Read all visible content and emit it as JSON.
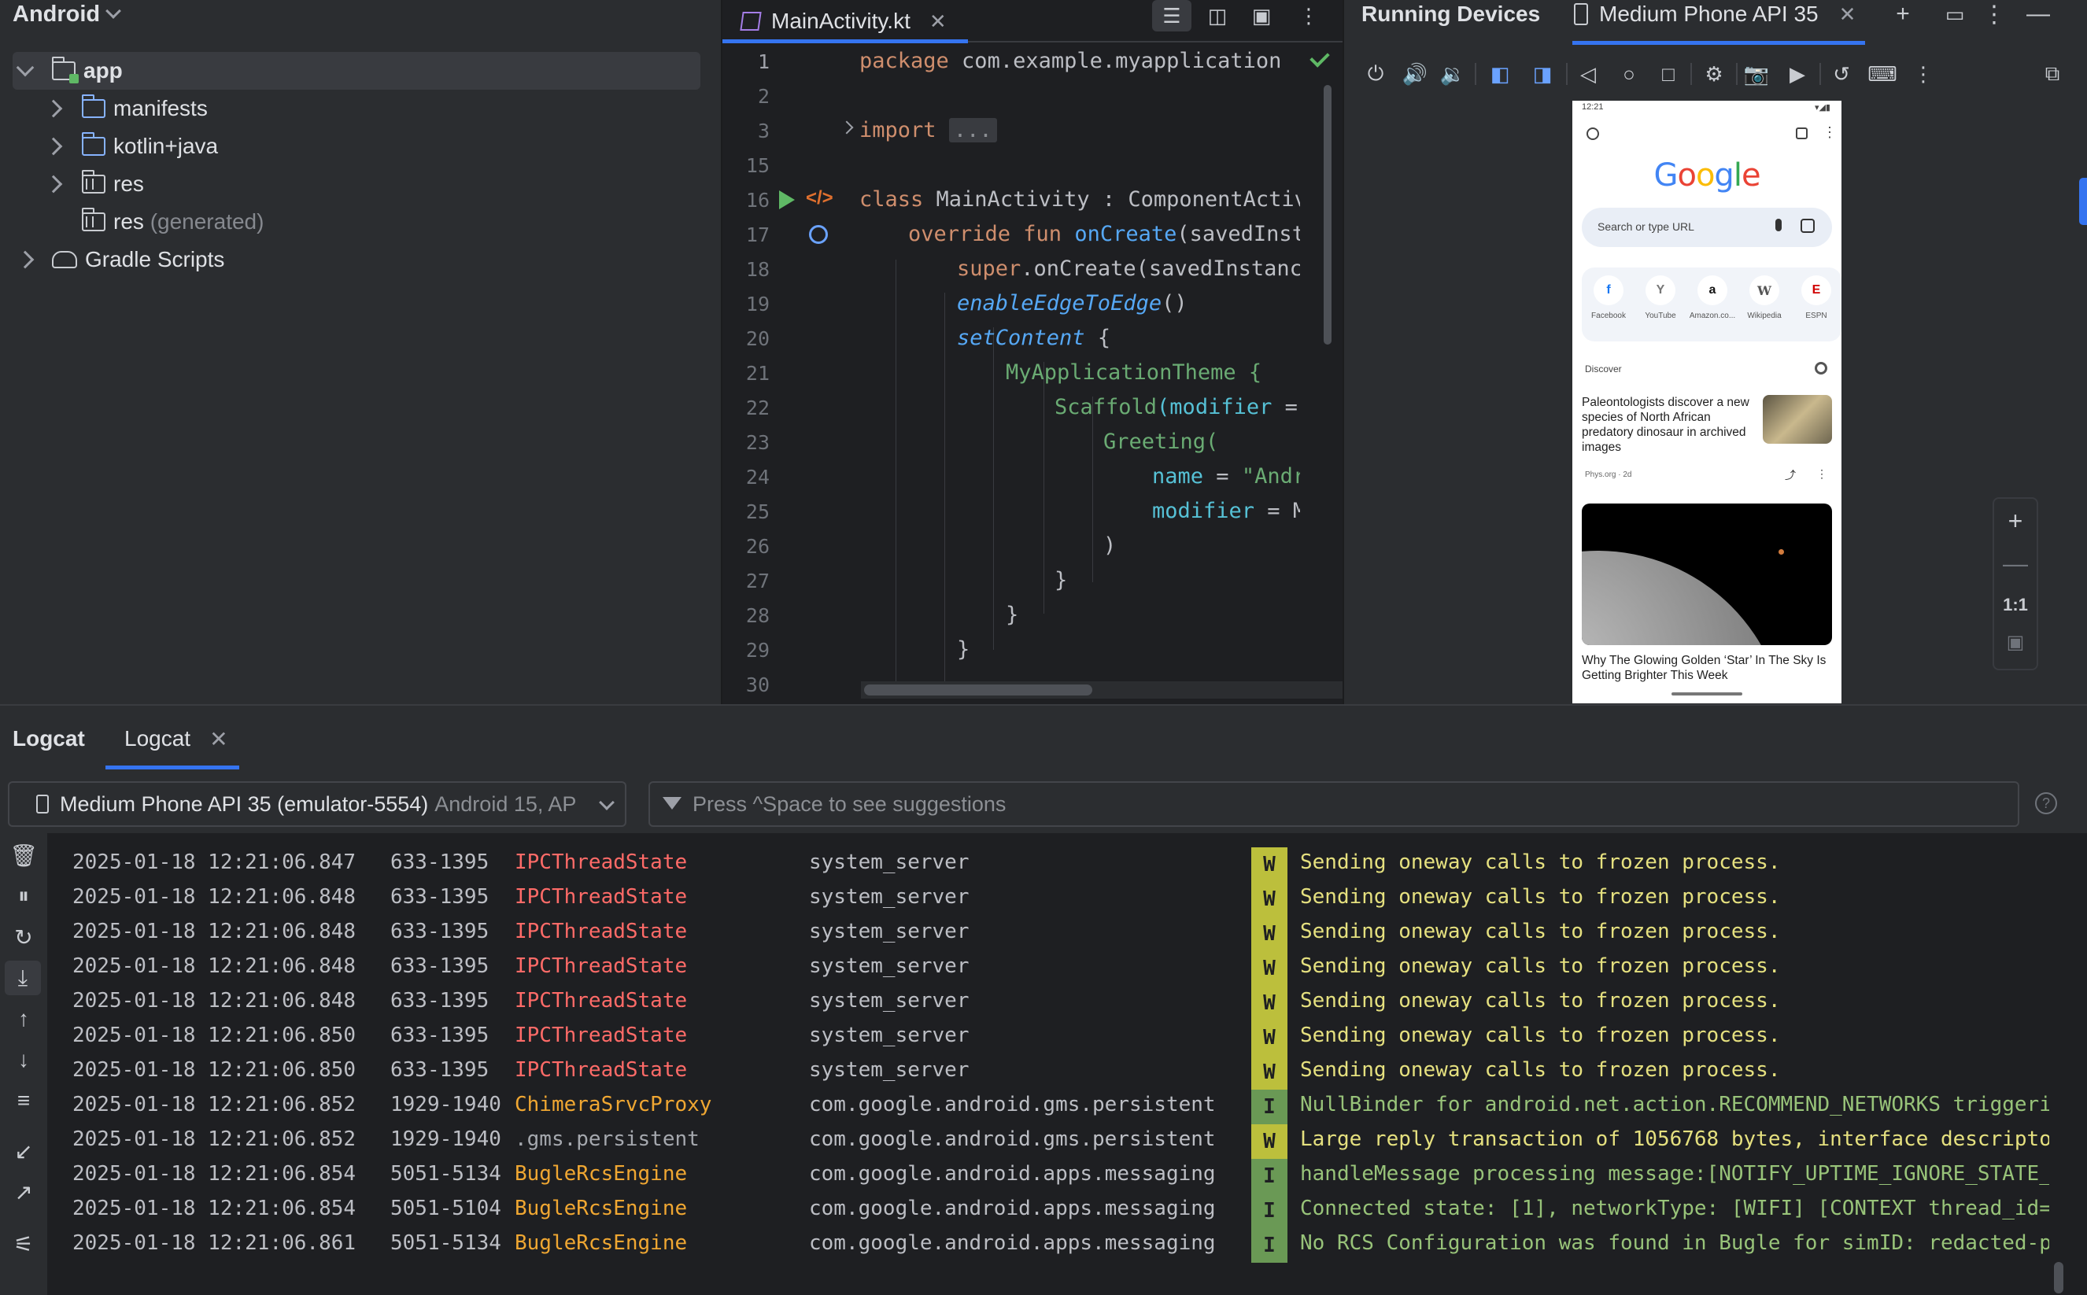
{
  "project": {
    "view_label": "Android",
    "tree": [
      {
        "label": "app",
        "suffix": "",
        "kind": "app",
        "expanded": true
      },
      {
        "label": "manifests",
        "suffix": "",
        "kind": "folder"
      },
      {
        "label": "kotlin+java",
        "suffix": "",
        "kind": "folder"
      },
      {
        "label": "res",
        "suffix": "",
        "kind": "res"
      },
      {
        "label": "res",
        "suffix": "(generated)",
        "kind": "res"
      },
      {
        "label": "Gradle Scripts",
        "suffix": "",
        "kind": "gradle"
      }
    ]
  },
  "editor": {
    "tab_label": "MainActivity.kt",
    "line_numbers": [
      "1",
      "2",
      "3",
      "15",
      "16",
      "17",
      "18",
      "19",
      "20",
      "21",
      "22",
      "23",
      "24",
      "25",
      "26",
      "27",
      "28",
      "29",
      "30"
    ],
    "code": {
      "l1_kw": "package",
      "l1_rest": " com.example.myapplication",
      "l3_kw": "import",
      "l3_fold": "...",
      "l16_kw": "class",
      "l16_rest": " MainActivity : ComponentActivity()",
      "l17_kw": "override fun",
      "l17_fn": " onCreate",
      "l17_rest": "(savedInstanceS",
      "l18_kw": "super",
      "l18_rest": ".onCreate(savedInstanceStat",
      "l19_it": "enableEdgeToEdge",
      "l19_rest": "()",
      "l20_it": "setContent",
      "l20_rest": " {",
      "l21": "MyApplicationTheme {",
      "l22_fn": "Scaffold",
      "l22_p": "(modifier",
      "l22_rest": " = Modi",
      "l23": "Greeting(",
      "l24_p": "name",
      "l24_eq": " = ",
      "l24_str": "\"Android\"",
      "l25_p": "modifier",
      "l25_rest": " = Modi",
      "l26": ")",
      "l27": "}",
      "l28": "}",
      "l29": "}"
    }
  },
  "devices": {
    "title": "Running Devices",
    "tab_label": "Medium Phone API 35",
    "zoom_label": "1:1",
    "phone": {
      "time": "12:21",
      "logo": "Google",
      "search_placeholder": "Search or type URL",
      "shortcuts": [
        {
          "label": "Facebook",
          "glyph": "f",
          "color": "#1877f2"
        },
        {
          "label": "YouTube",
          "glyph": "Y",
          "color": "#777777"
        },
        {
          "label": "Amazon.co...",
          "glyph": "a",
          "color": "#111111"
        },
        {
          "label": "Wikipedia",
          "glyph": "W",
          "color": "#555555"
        },
        {
          "label": "ESPN",
          "glyph": "E",
          "color": "#d00000"
        }
      ],
      "discover_label": "Discover",
      "news1_title": "Paleontologists discover a new species of North African predatory dinosaur in archived images",
      "news1_source": "Phys.org · 2d",
      "news2_title": "Why The Glowing Golden ‘Star’ In The Sky Is Getting Brighter This Week"
    }
  },
  "logcat": {
    "title": "Logcat",
    "tab_label": "Logcat",
    "device_selector": "Medium Phone API 35 (emulator-5554)",
    "device_selector_sub": "Android 15, AP",
    "filter_placeholder": "Press ^Space to see suggestions",
    "colors": {
      "tag_warn": "#ff6b68",
      "tag_info": "#f0a732",
      "level_w": "#bcbf3c",
      "level_i": "#6a9955",
      "msg_w": "#e5e07f",
      "msg_i": "#98c379"
    },
    "rows": [
      {
        "ts": "2025-01-18 12:21:06.847",
        "pid": "633-1395",
        "tag": "IPCThreadState",
        "pkg": "system_server",
        "level": "W",
        "msg": "Sending oneway calls to frozen process."
      },
      {
        "ts": "2025-01-18 12:21:06.848",
        "pid": "633-1395",
        "tag": "IPCThreadState",
        "pkg": "system_server",
        "level": "W",
        "msg": "Sending oneway calls to frozen process."
      },
      {
        "ts": "2025-01-18 12:21:06.848",
        "pid": "633-1395",
        "tag": "IPCThreadState",
        "pkg": "system_server",
        "level": "W",
        "msg": "Sending oneway calls to frozen process."
      },
      {
        "ts": "2025-01-18 12:21:06.848",
        "pid": "633-1395",
        "tag": "IPCThreadState",
        "pkg": "system_server",
        "level": "W",
        "msg": "Sending oneway calls to frozen process."
      },
      {
        "ts": "2025-01-18 12:21:06.848",
        "pid": "633-1395",
        "tag": "IPCThreadState",
        "pkg": "system_server",
        "level": "W",
        "msg": "Sending oneway calls to frozen process."
      },
      {
        "ts": "2025-01-18 12:21:06.850",
        "pid": "633-1395",
        "tag": "IPCThreadState",
        "pkg": "system_server",
        "level": "W",
        "msg": "Sending oneway calls to frozen process."
      },
      {
        "ts": "2025-01-18 12:21:06.850",
        "pid": "633-1395",
        "tag": "IPCThreadState",
        "pkg": "system_server",
        "level": "W",
        "msg": "Sending oneway calls to frozen process."
      },
      {
        "ts": "2025-01-18 12:21:06.852",
        "pid": "1929-1940",
        "tag": "ChimeraSrvcProxy",
        "pkg": "com.google.android.gms.persistent",
        "level": "I",
        "msg": "NullBinder for android.net.action.RECOMMEND_NETWORKS triggeri"
      },
      {
        "ts": "2025-01-18 12:21:06.852",
        "pid": "1929-1940",
        "tag": ".gms.persistent",
        "pkg": "com.google.android.gms.persistent",
        "level": "W",
        "msg": "Large reply transaction of 1056768 bytes, interface descripto"
      },
      {
        "ts": "2025-01-18 12:21:06.854",
        "pid": "5051-5134",
        "tag": "BugleRcsEngine",
        "pkg": "com.google.android.apps.messaging",
        "level": "I",
        "msg": "handleMessage processing message:[NOTIFY_UPTIME_IGNORE_STATE_"
      },
      {
        "ts": "2025-01-18 12:21:06.854",
        "pid": "5051-5104",
        "tag": "BugleRcsEngine",
        "pkg": "com.google.android.apps.messaging",
        "level": "I",
        "msg": "Connected state: [1], networkType: [WIFI] [CONTEXT thread_id="
      },
      {
        "ts": "2025-01-18 12:21:06.861",
        "pid": "5051-5134",
        "tag": "BugleRcsEngine",
        "pkg": "com.google.android.apps.messaging",
        "level": "I",
        "msg": "No RCS Configuration was found in Bugle for simID: redacted-p"
      }
    ]
  }
}
